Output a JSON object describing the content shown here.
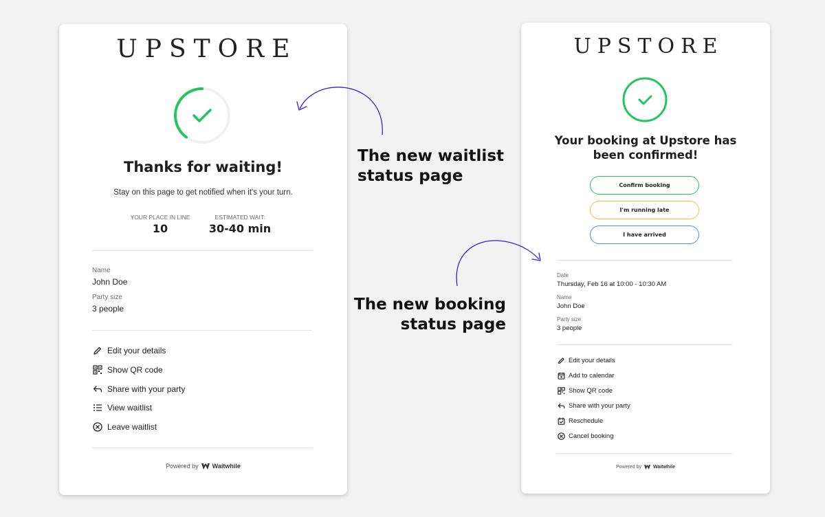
{
  "waitlist": {
    "logo": "UPSTORE",
    "title": "Thanks for waiting!",
    "subtitle": "Stay on this page to get notified when it's your turn.",
    "place_label": "YOUR PLACE IN LINE",
    "place_value": "10",
    "wait_label": "ESTIMATED WAIT:",
    "wait_value": "30-40 min",
    "progress_fraction": 0.4,
    "name_label": "Name",
    "name_value": "John Doe",
    "party_label": "Party size",
    "party_value": "3 people",
    "actions": [
      "Edit your details",
      "Show QR code",
      "Share with your party",
      "View waitlist",
      "Leave waitlist"
    ],
    "powered_by": "Powered by",
    "brand": "Waitwhile"
  },
  "booking": {
    "logo": "UPSTORE",
    "title_line1": "Your booking at Upstore has",
    "title_line2": "been confirmed!",
    "buttons": [
      "Confirm booking",
      "I'm running late",
      "I have arrived"
    ],
    "date_label": "Date",
    "date_value": "Thursday, Feb 16 at 10:00 - 10:30 AM",
    "name_label": "Name",
    "name_value": "John Doe",
    "party_label": "Party size",
    "party_value": "3 people",
    "actions": [
      "Edit your details",
      "Add to calendar",
      "Show QR code",
      "Share with your party",
      "Reschedule",
      "Cancel booking"
    ],
    "powered_by": "Powered by",
    "brand": "Waitwhile"
  },
  "callouts": {
    "waitlist_line1": "The new waitlist",
    "waitlist_line2": "status page",
    "booking_line1": "The new booking",
    "booking_line2": "status page"
  },
  "colors": {
    "success_green": "#22c55e",
    "late_orange": "#f5b942",
    "arrived_blue": "#4a90e2",
    "arrow_purple": "#3b1fd6"
  }
}
